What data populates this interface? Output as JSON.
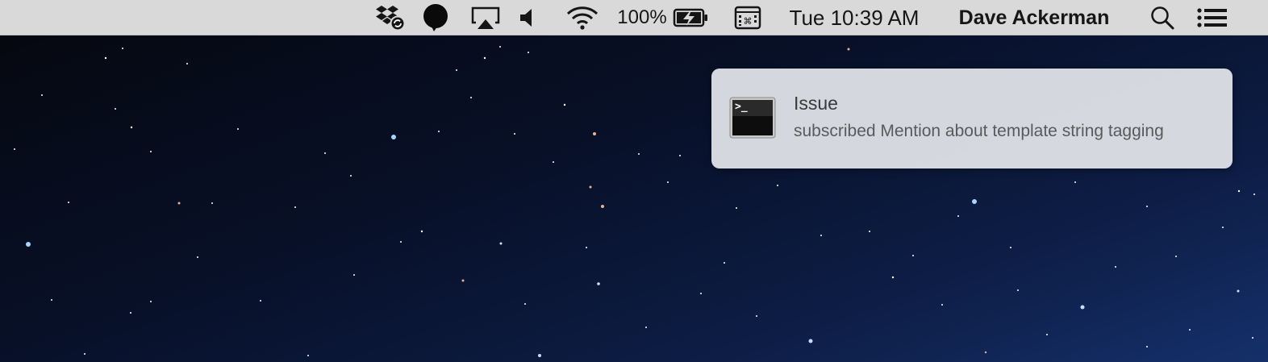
{
  "menubar": {
    "items": [
      {
        "icon": "dropbox-sync-icon"
      },
      {
        "icon": "speech-bubble-icon"
      },
      {
        "icon": "airplay-icon"
      },
      {
        "icon": "volume-icon"
      },
      {
        "icon": "wifi-icon"
      },
      {
        "battery_percent": "100%",
        "icon": "battery-charging-icon"
      },
      {
        "icon": "keyboard-icon"
      }
    ],
    "clock": "Tue 10:39 AM",
    "user": "Dave Ackerman",
    "spotlight_icon": "search-icon",
    "notification_center_icon": "list-icon"
  },
  "notification": {
    "app_icon": "terminal-icon",
    "icon_glyph": ">_",
    "title": "Issue",
    "body": "subscribed Mention about template string tagging"
  },
  "colors": {
    "menubar_bg": "#d9d9d9",
    "notification_bg": "#dee0e6",
    "desktop_dark": "#05070d",
    "desktop_light": "#15306a"
  }
}
